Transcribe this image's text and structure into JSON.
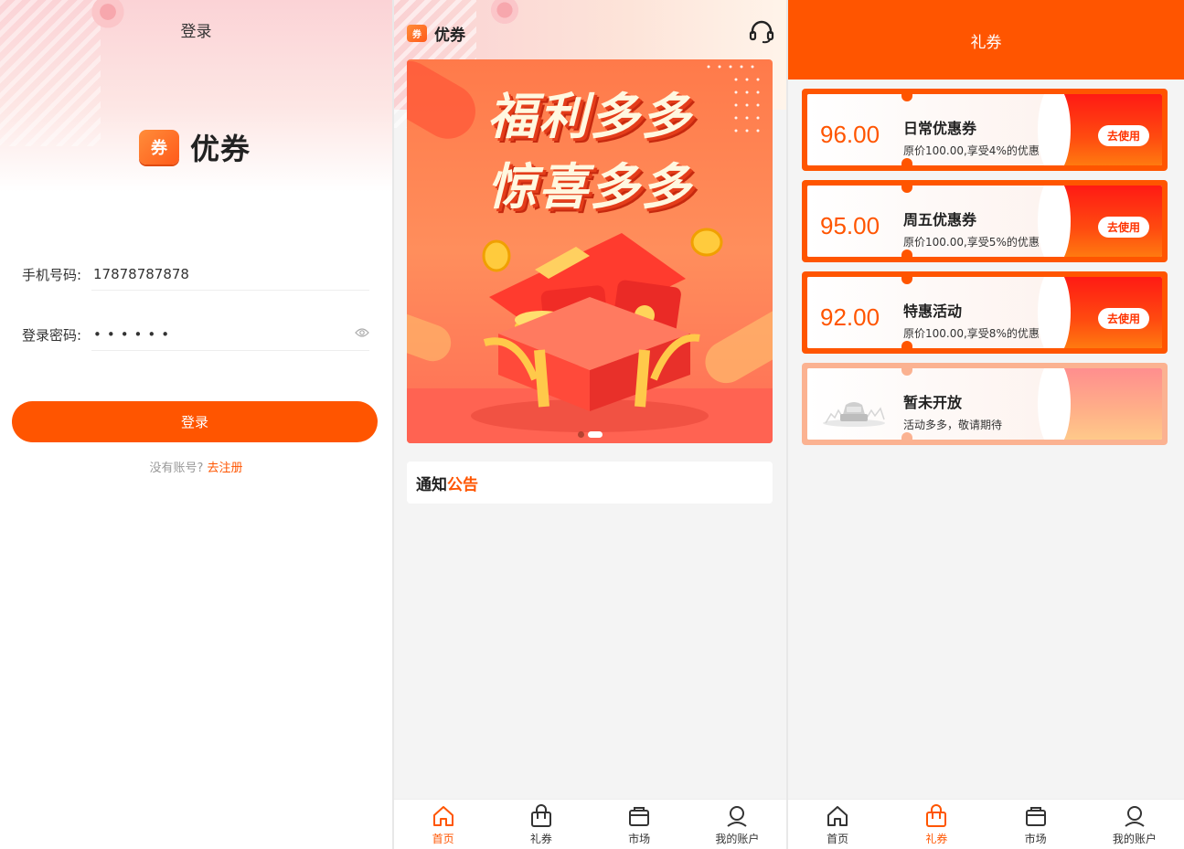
{
  "login": {
    "title": "登录",
    "logo_badge": "券",
    "brand": "优券",
    "phone_label": "手机号码:",
    "phone_value": "17878787878",
    "password_label": "登录密码:",
    "password_value": "••••••",
    "login_button": "登录",
    "register_prompt": "没有账号?",
    "register_link": "去注册"
  },
  "home": {
    "logo_badge": "券",
    "brand": "优券",
    "banner_line1": "福利多多",
    "banner_line2": "惊喜多多",
    "notice_title_main": "通知",
    "notice_title_accent": "公告",
    "carousel_active_index": 1
  },
  "tabbar_home": {
    "items": [
      {
        "label": "首页",
        "icon": "home-icon",
        "active": true
      },
      {
        "label": "礼券",
        "icon": "bag-icon",
        "active": false
      },
      {
        "label": "市场",
        "icon": "shop-icon",
        "active": false
      },
      {
        "label": "我的账户",
        "icon": "user-icon",
        "active": false
      }
    ]
  },
  "tabbar_coupons": {
    "items": [
      {
        "label": "首页",
        "icon": "home-icon",
        "active": false
      },
      {
        "label": "礼券",
        "icon": "bag-icon",
        "active": true
      },
      {
        "label": "市场",
        "icon": "shop-icon",
        "active": false
      },
      {
        "label": "我的账户",
        "icon": "user-icon",
        "active": false
      }
    ]
  },
  "coupons": {
    "title": "礼券",
    "items": [
      {
        "amount": "96.00",
        "name": "日常优惠券",
        "desc": "原价100.00,享受4%的优惠",
        "button": "去使用"
      },
      {
        "amount": "95.00",
        "name": "周五优惠券",
        "desc": "原价100.00,享受5%的优惠",
        "button": "去使用"
      },
      {
        "amount": "92.00",
        "name": "特惠活动",
        "desc": "原价100.00,享受8%的优惠",
        "button": "去使用"
      },
      {
        "name": "暂未开放",
        "desc": "活动多多，敬请期待"
      }
    ]
  },
  "colors": {
    "primary": "#ff5500",
    "disabled": "#fbb291"
  }
}
